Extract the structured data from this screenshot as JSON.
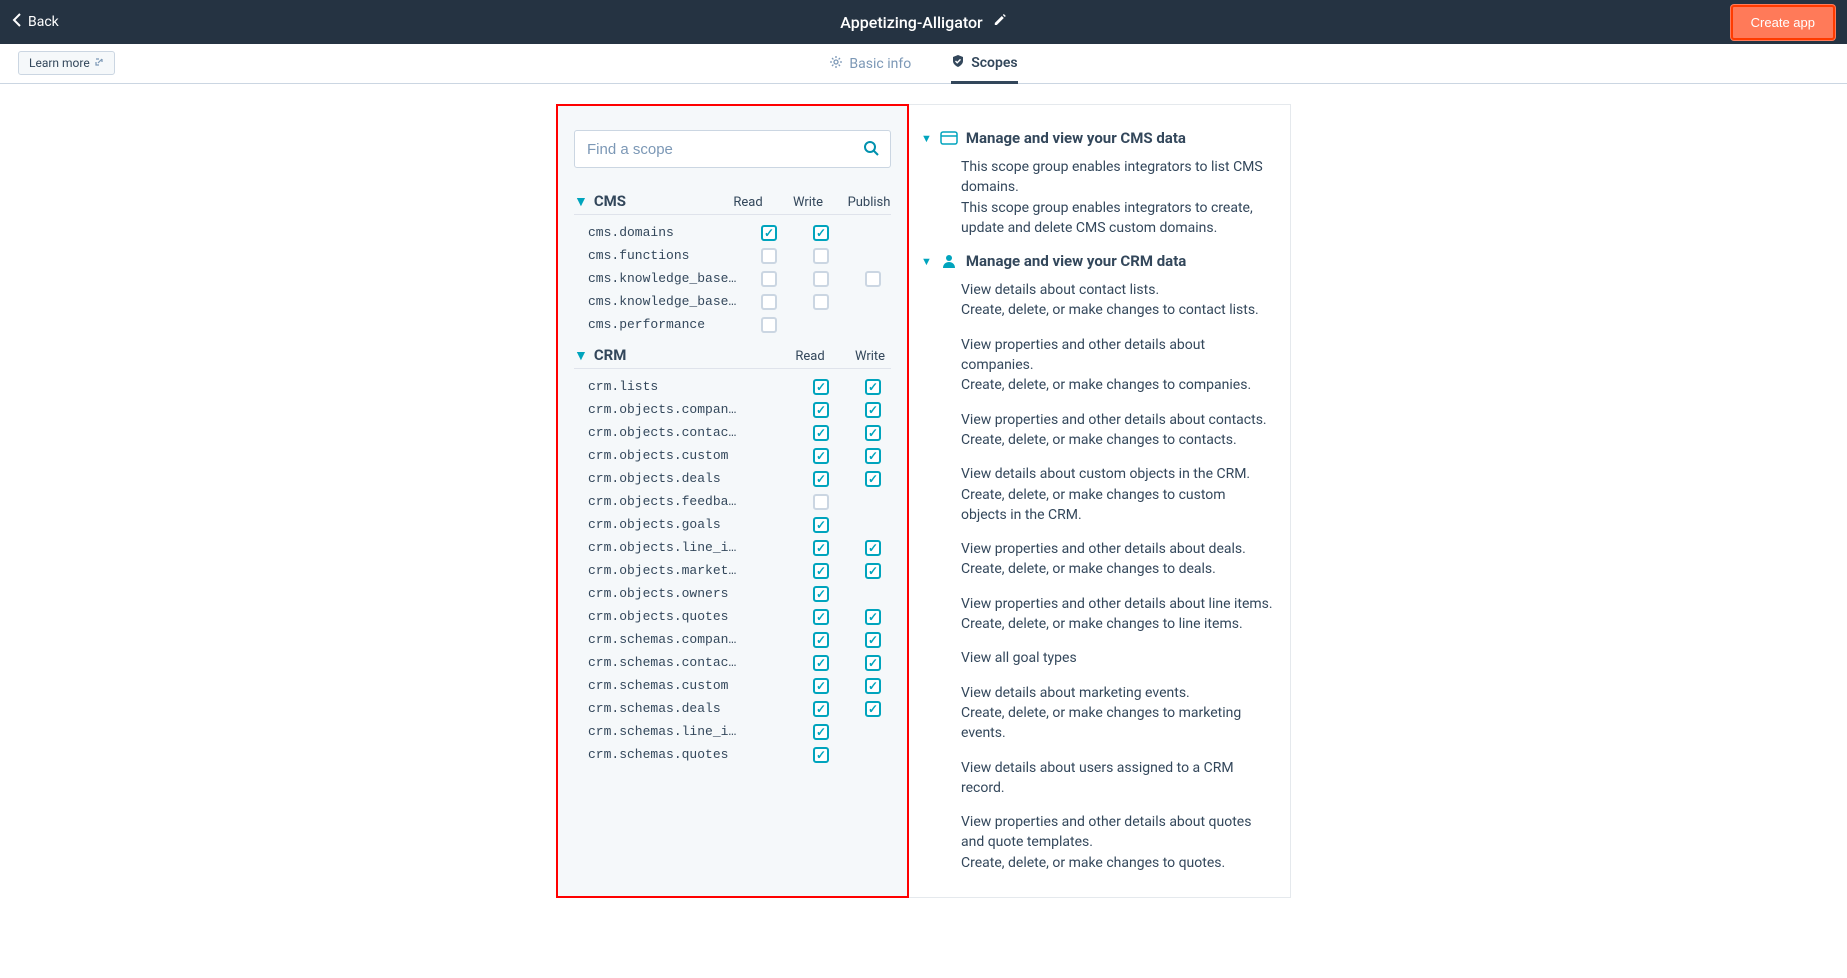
{
  "header": {
    "back": "Back",
    "title": "Appetizing-Alligator",
    "create": "Create app"
  },
  "subnav": {
    "learn_more": "Learn more",
    "tab_basic": "Basic info",
    "tab_scopes": "Scopes"
  },
  "search": {
    "placeholder": "Find a scope"
  },
  "cols": {
    "read": "Read",
    "write": "Write",
    "publish": "Publish"
  },
  "groups": [
    {
      "name": "CMS",
      "has_publish": true,
      "scopes": [
        {
          "name": "cms.domains",
          "read": true,
          "write": true,
          "publish": null
        },
        {
          "name": "cms.functions",
          "read": false,
          "write": false,
          "publish": null
        },
        {
          "name": "cms.knowledge_base.…",
          "read": false,
          "write": false,
          "publish": false
        },
        {
          "name": "cms.knowledge_base.…",
          "read": false,
          "write": false,
          "publish": null
        },
        {
          "name": "cms.performance",
          "read": false,
          "write": null,
          "publish": null
        }
      ]
    },
    {
      "name": "CRM",
      "has_publish": false,
      "scopes": [
        {
          "name": "crm.lists",
          "read": true,
          "write": true
        },
        {
          "name": "crm.objects.compani…",
          "read": true,
          "write": true
        },
        {
          "name": "crm.objects.contacts",
          "read": true,
          "write": true
        },
        {
          "name": "crm.objects.custom",
          "read": true,
          "write": true
        },
        {
          "name": "crm.objects.deals",
          "read": true,
          "write": true
        },
        {
          "name": "crm.objects.feedbac…",
          "read": false,
          "write": null
        },
        {
          "name": "crm.objects.goals",
          "read": true,
          "write": null
        },
        {
          "name": "crm.objects.line_it…",
          "read": true,
          "write": true
        },
        {
          "name": "crm.objects.marketi…",
          "read": true,
          "write": true
        },
        {
          "name": "crm.objects.owners",
          "read": true,
          "write": null
        },
        {
          "name": "crm.objects.quotes",
          "read": true,
          "write": true
        },
        {
          "name": "crm.schemas.compani…",
          "read": true,
          "write": true
        },
        {
          "name": "crm.schemas.contacts",
          "read": true,
          "write": true
        },
        {
          "name": "crm.schemas.custom",
          "read": true,
          "write": true
        },
        {
          "name": "crm.schemas.deals",
          "read": true,
          "write": true
        },
        {
          "name": "crm.schemas.line_it…",
          "read": true,
          "write": null
        },
        {
          "name": "crm.schemas.quotes",
          "read": true,
          "write": null
        }
      ]
    }
  ],
  "desc": {
    "cms": {
      "title": "Manage and view your CMS data",
      "lines": [
        "This scope group enables integrators to list CMS domains.",
        "This scope group enables integrators to create, update and delete CMS custom domains."
      ]
    },
    "crm": {
      "title": "Manage and view your CRM data",
      "blocks": [
        [
          "View details about contact lists.",
          "Create, delete, or make changes to contact lists."
        ],
        [
          "View properties and other details about companies.",
          "Create, delete, or make changes to companies."
        ],
        [
          "View properties and other details about contacts.",
          "Create, delete, or make changes to contacts."
        ],
        [
          "View details about custom objects in the CRM.",
          "Create, delete, or make changes to custom objects in the CRM."
        ],
        [
          "View properties and other details about deals.",
          "Create, delete, or make changes to deals."
        ],
        [
          "View properties and other details about line items.",
          "Create, delete, or make changes to line items."
        ],
        [
          "View all goal types"
        ],
        [
          "View details about marketing events.",
          "Create, delete, or make changes to marketing events."
        ],
        [
          "View details about users assigned to a CRM record."
        ],
        [
          "View properties and other details about quotes and quote templates.",
          "Create, delete, or make changes to quotes."
        ]
      ]
    }
  }
}
